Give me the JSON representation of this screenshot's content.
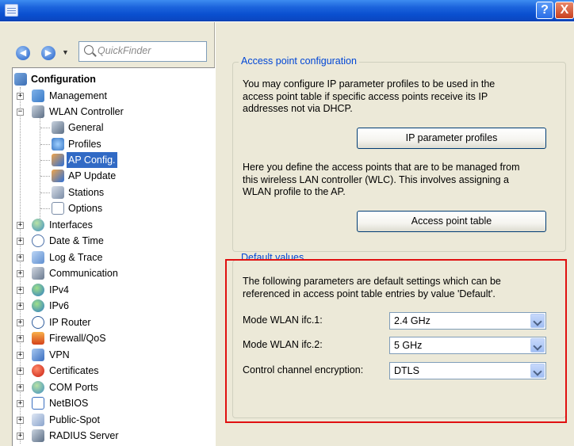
{
  "search": {
    "placeholder": "QuickFinder"
  },
  "titlebar": {
    "help_label": "?",
    "close_label": "X"
  },
  "tree": {
    "root": "Configuration",
    "management": "Management",
    "wlan_controller": "WLAN Controller",
    "wlan_children": [
      "General",
      "Profiles",
      "AP Config.",
      "AP Update",
      "Stations",
      "Options"
    ],
    "top_items": [
      "Interfaces",
      "Date & Time",
      "Log & Trace",
      "Communication",
      "IPv4",
      "IPv6",
      "IP Router",
      "Firewall/QoS",
      "VPN",
      "Certificates",
      "COM Ports",
      "NetBIOS",
      "Public-Spot",
      "RADIUS Server"
    ],
    "selected": "AP Config."
  },
  "ap_config": {
    "title": "Access point configuration",
    "text1": [
      "You may configure IP parameter profiles to be used in the",
      "access point table if specific access points receive its IP",
      "addresses not via DHCP."
    ],
    "button1": "IP parameter profiles",
    "text2": [
      "Here you define the access points that are to be managed from",
      "this wireless LAN controller (WLC). This involves assigning a",
      "WLAN profile to the AP."
    ],
    "button2": "Access point table"
  },
  "defaults": {
    "title": "Default values",
    "text": [
      "The following parameters are default settings which can be",
      "referenced in access point table entries by value 'Default'."
    ],
    "fields": [
      {
        "label": "Mode WLAN ifc.1:",
        "value": "2.4 GHz"
      },
      {
        "label": "Mode WLAN ifc.2:",
        "value": "5 GHz"
      },
      {
        "label": "Control channel encryption:",
        "value": "DTLS"
      }
    ]
  },
  "colors": {
    "selection": "#316ac5",
    "group_title": "#0046d5",
    "highlight_box": "#e01010",
    "titlebar": "#0a4fd0"
  }
}
